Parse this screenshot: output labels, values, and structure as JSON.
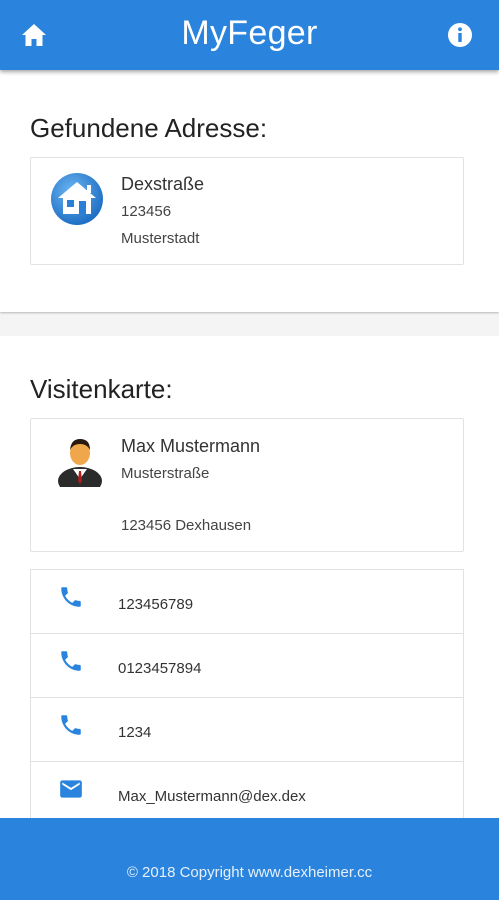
{
  "header": {
    "title": "MyFeger",
    "home_icon": "home-icon",
    "info_icon": "info-icon",
    "color": "#2a84dd"
  },
  "address_section": {
    "title": "Gefundene Adresse:",
    "icon": "house-icon",
    "street": "Dexstraße",
    "zip": "123456",
    "city": "Musterstadt"
  },
  "business_card": {
    "title": "Visitenkarte:",
    "icon": "person-avatar-icon",
    "name": "Max Mustermann",
    "street": "Musterstraße",
    "city": "123456 Dexhausen",
    "contacts": [
      {
        "icon": "phone-icon",
        "value": "123456789"
      },
      {
        "icon": "phone-icon",
        "value": "0123457894"
      },
      {
        "icon": "phone-icon",
        "value": "1234"
      },
      {
        "icon": "mail-icon",
        "value": "Max_Mustermann@dex.dex"
      }
    ]
  },
  "footer": {
    "text": "© 2018 Copyright www.dexheimer.cc"
  }
}
